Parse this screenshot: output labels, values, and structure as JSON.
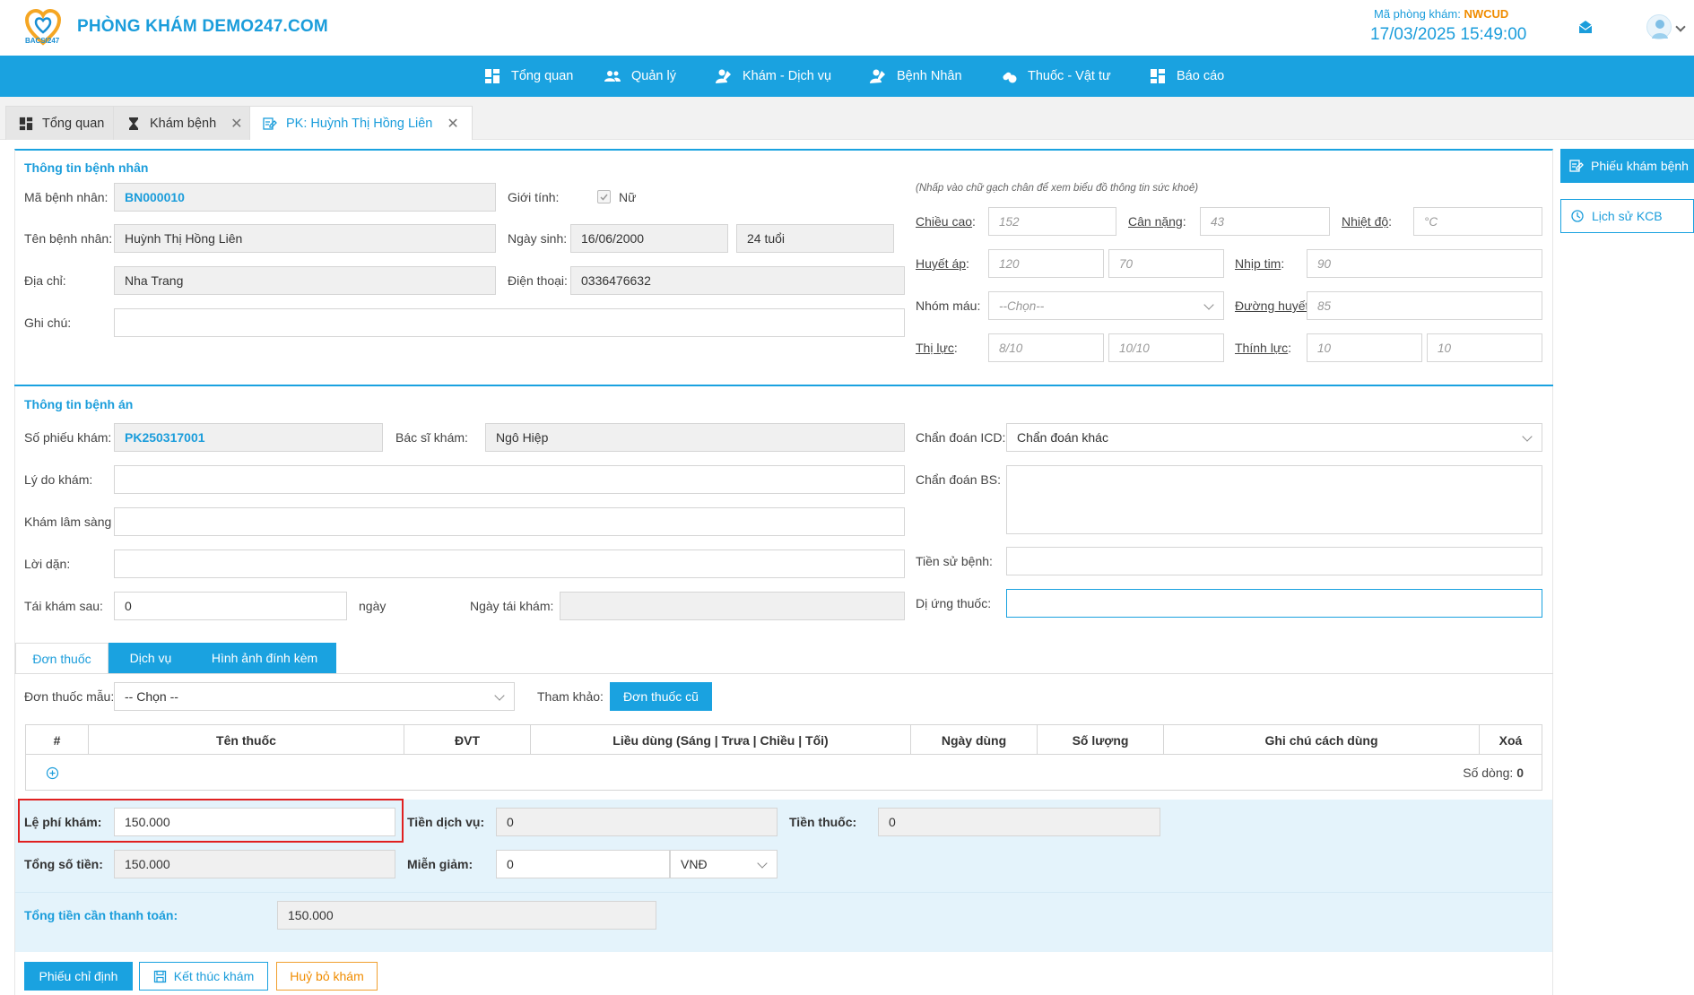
{
  "header": {
    "clinic_name": "PHÒNG KHÁM DEMO247.COM",
    "logo_text": "BACSI247",
    "code_label": "Mã phòng khám:",
    "code_value": "NWCUD",
    "datetime": "17/03/2025 15:49:00",
    "brand_color": "#1aa2e0"
  },
  "nav": [
    {
      "label": "Tổng quan",
      "icon": "dashboard-icon"
    },
    {
      "label": "Quản lý",
      "icon": "users-icon"
    },
    {
      "label": "Khám - Dịch vụ",
      "icon": "user-edit-icon"
    },
    {
      "label": "Bệnh Nhân",
      "icon": "user-edit-icon"
    },
    {
      "label": "Thuốc - Vật tư",
      "icon": "pills-icon"
    },
    {
      "label": "Báo cáo",
      "icon": "dashboard-icon"
    }
  ],
  "tabs": [
    {
      "label": "Tổng quan"
    },
    {
      "label": "Khám bệnh"
    },
    {
      "label": "PK: Huỳnh Thị Hồng Liên"
    }
  ],
  "patient": {
    "title": "Thông tin bệnh nhân",
    "id_label": "Mã bệnh nhân",
    "id_value": "BN000010",
    "gender_label": "Giới tính",
    "gender_value": "Nữ",
    "name_label": "Tên bệnh nhân",
    "name_value": "Huỳnh Thị Hồng Liên",
    "dob_label": "Ngày sinh",
    "dob_value": "16/06/2000",
    "age_value": "24 tuổi",
    "address_label": "Địa chỉ",
    "address_value": "Nha Trang",
    "phone_label": "Điện thoại",
    "phone_value": "0336476632",
    "note_label": "Ghi chú"
  },
  "vitals": {
    "hint": "(Nhấp vào chữ gạch chân để xem biểu đồ thông tin sức khoẻ)",
    "height_label": "Chiều cao",
    "height_ph": "152",
    "weight_label": "Cân nặng",
    "weight_ph": "43",
    "temp_label": "Nhiệt độ",
    "temp_ph": "°C",
    "bp_label": "Huyết áp",
    "bp_sys_ph": "120",
    "bp_dia_ph": "70",
    "hr_label": "Nhịp tim",
    "hr_ph": "90",
    "blood_label": "Nhóm máu",
    "blood_value": "--Chọn--",
    "glucose_label": "Đường huyết",
    "glucose_ph": "85",
    "vision_label": "Thị lực",
    "vision_l_ph": "8/10",
    "vision_r_ph": "10/10",
    "hearing_label": "Thính lực",
    "hearing_l_ph": "10",
    "hearing_r_ph": "10"
  },
  "record": {
    "title": "Thông tin bệnh án",
    "ticket_label": "Số phiếu khám",
    "ticket_value": "PK250317001",
    "doctor_label": "Bác sĩ khám",
    "doctor_value": "Ngô Hiệp",
    "icd_label": "Chẩn đoán ICD",
    "icd_value": "Chẩn đoán khác",
    "reason_label": "Lý do khám",
    "diag_label": "Chẩn đoán BS",
    "clinical_label": "Khám lâm sàng",
    "advice_label": "Lời dặn",
    "history_label": "Tiền sử bệnh",
    "revisit_label": "Tái khám sau",
    "revisit_value": "0",
    "revisit_unit": "ngày",
    "revisit_date_label": "Ngày tái khám",
    "allergy_label": "Dị ứng thuốc"
  },
  "subtabs": [
    "Đơn thuốc",
    "Dịch vụ",
    "Hình ảnh đính kèm"
  ],
  "prescription": {
    "template_label": "Đơn thuốc mẫu",
    "template_value": "-- Chọn --",
    "ref_label": "Tham khảo:",
    "old_button": "Đơn thuốc cũ",
    "columns": [
      "#",
      "Tên thuốc",
      "ĐVT",
      "Liều dùng (Sáng | Trưa | Chiều | Tối)",
      "Ngày dùng",
      "Số lượng",
      "Ghi chú cách dùng",
      "Xoá"
    ],
    "rows_label": "Số dòng:",
    "rows_value": "0"
  },
  "payment": {
    "fee_label": "Lệ phí khám",
    "fee_value": "150.000",
    "service_label": "Tiền dịch vụ",
    "service_value": "0",
    "drug_label": "Tiền thuốc",
    "drug_value": "0",
    "total_label": "Tổng số tiền",
    "total_value": "150.000",
    "discount_label": "Miễn giảm",
    "discount_value": "0",
    "currency_value": "VNĐ",
    "due_label": "Tổng tiền cần thanh toán",
    "due_value": "150.000"
  },
  "actions": {
    "order_button": "Phiếu chỉ định",
    "finish_button": "Kết thúc khám",
    "cancel_button": "Huỷ bỏ khám"
  },
  "side": {
    "ticket_button": "Phiếu khám bệnh",
    "history_button": "Lịch sử KCB"
  }
}
